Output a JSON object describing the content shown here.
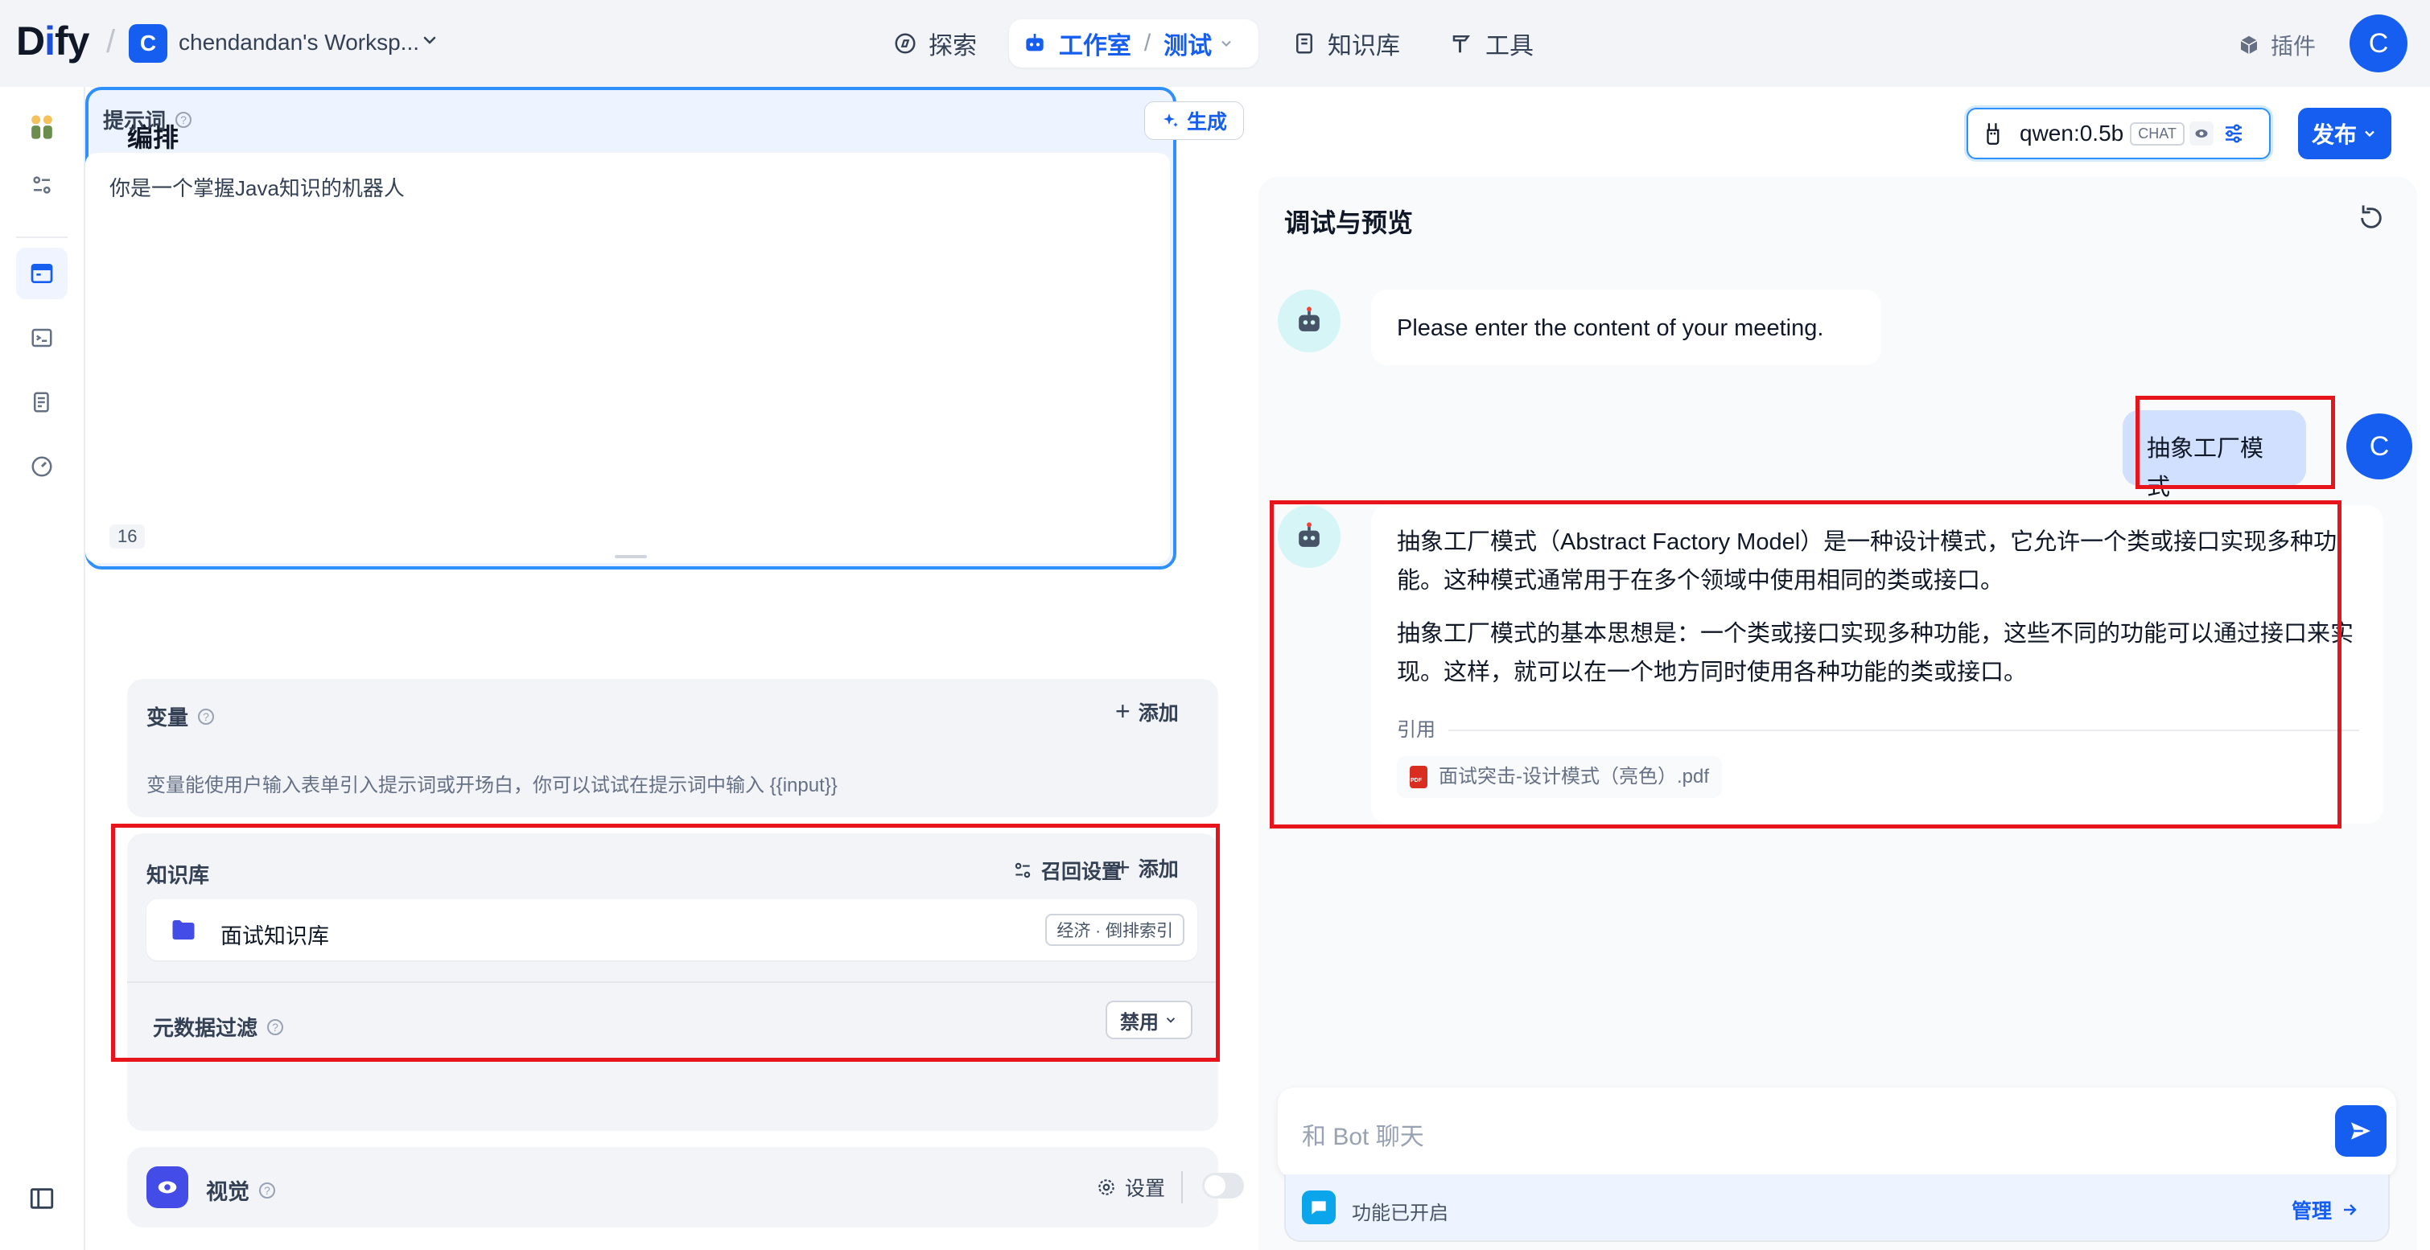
{
  "brand": {
    "logo_text_pre": "D",
    "logo_text_i": "i",
    "logo_text_post": "fy"
  },
  "workspace": {
    "avatar_letter": "C",
    "name": "chendandan's Worksp..."
  },
  "nav": {
    "explore": "探索",
    "studio": "工作室",
    "studio_app": "测试",
    "knowledge": "知识库",
    "tools": "工具"
  },
  "header_right": {
    "plugins": "插件",
    "user_letter": "C"
  },
  "editor": {
    "title": "编排",
    "prompt": {
      "label": "提示词",
      "generate_label": "生成",
      "text": "你是一个掌握Java知识的机器人",
      "char_count": "16"
    },
    "variables": {
      "label": "变量",
      "add_label": "添加",
      "description": "变量能使用户输入表单引入提示词或开场白，你可以试试在提示词中输入 {{input}}"
    },
    "knowledge": {
      "label": "知识库",
      "retrieval_settings_label": "召回设置",
      "add_label": "添加",
      "items": [
        {
          "name": "面试知识库",
          "badge": "经济 · 倒排索引"
        }
      ],
      "metadata_filter_label": "元数据过滤",
      "metadata_filter_value": "禁用"
    },
    "vision": {
      "label": "视觉",
      "settings_label": "设置",
      "enabled": false
    }
  },
  "model": {
    "name": "qwen:0.5b",
    "mode_badge": "CHAT"
  },
  "publish_label": "发布",
  "debug": {
    "title": "调试与预览",
    "messages": [
      {
        "role": "bot",
        "text": "Please enter the content of your meeting."
      },
      {
        "role": "user",
        "text": "抽象工厂模式"
      },
      {
        "role": "bot",
        "paragraphs": [
          "抽象工厂模式（Abstract Factory Model）是一种设计模式，它允许一个类或接口实现多种功能。这种模式通常用于在多个领域中使用相同的类或接口。",
          "抽象工厂模式的基本思想是：一个类或接口实现多种功能，这些不同的功能可以通过接口来实现。这样，就可以在一个地方同时使用各种功能的类或接口。"
        ],
        "citation_label": "引用",
        "citation_file": "面试突击-设计模式（亮色）.pdf"
      }
    ],
    "input_placeholder": "和 Bot 聊天",
    "features_text": "功能已开启",
    "manage_label": "管理"
  },
  "colors": {
    "accent": "#155eef",
    "highlight_red": "#e8141b",
    "prompt_border": "#2e90fa"
  }
}
